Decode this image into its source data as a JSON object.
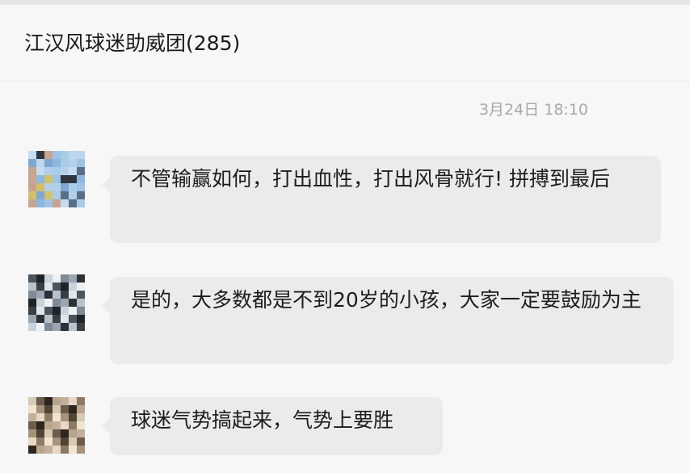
{
  "chat": {
    "title": "江汉风球迷助威团(285)",
    "timestamp": "3月24日 18:10"
  },
  "messages": [
    {
      "text": "不管输赢如何，打出血性，打出风骨就行! 拼搏到最后"
    },
    {
      "text": "是的，大多数都是不到20岁的小孩，大家一定要鼓励为主"
    },
    {
      "text": "球迷气势搞起来，气势上要胜"
    }
  ]
}
